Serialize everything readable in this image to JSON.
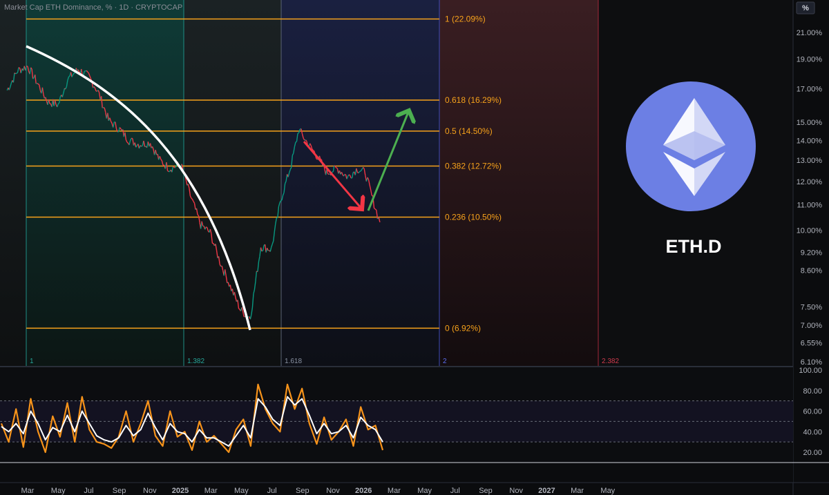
{
  "header": {
    "legend": "Market Cap ETH Dominance, % · 1D · CRYPTOCAP",
    "unit_button": "%"
  },
  "overlay": {
    "ticker": "ETH.D",
    "logo": "ethereum-icon",
    "logo_color": "#6c7fe4"
  },
  "chart_data": [
    {
      "type": "line",
      "title": "",
      "xlabel": "",
      "ylabel": "",
      "y_scale": "log",
      "ylim": [
        6.1,
        22.8
      ],
      "y_ticks": [
        "21.00%",
        "19.00%",
        "17.00%",
        "15.00%",
        "14.00%",
        "13.00%",
        "12.00%",
        "11.00%",
        "10.00%",
        "9.20%",
        "8.60%",
        "7.50%",
        "7.00%",
        "6.55%",
        "6.10%"
      ],
      "x_ticks": [
        "Mar",
        "May",
        "Jul",
        "Sep",
        "Nov",
        "2025",
        "Mar",
        "May",
        "Jul",
        "Sep",
        "Nov",
        "2026",
        "Mar",
        "May",
        "Jul",
        "Sep",
        "Nov",
        "2027",
        "Mar",
        "May"
      ],
      "x_range": [
        "2024-02",
        "2027-06"
      ],
      "series": [
        {
          "name": "",
          "color": "#089981",
          "x": [
            "2024-01-20",
            "2024-02-10",
            "2024-03-01",
            "2024-03-20",
            "2024-04-10",
            "2024-05-01",
            "2024-05-20",
            "2024-06-10",
            "2024-07-01",
            "2024-07-20",
            "2024-08-10",
            "2024-09-01",
            "2024-09-20",
            "2024-10-10",
            "2024-11-01",
            "2024-11-20",
            "2024-12-10",
            "2025-01-01",
            "2025-01-20",
            "2025-02-10",
            "2025-03-01",
            "2025-03-20",
            "2025-04-10",
            "2025-05-01",
            "2025-05-20",
            "2025-06-10",
            "2025-07-01",
            "2025-07-20",
            "2025-08-10",
            "2025-08-25",
            "2025-09-10",
            "2025-10-01",
            "2025-10-20",
            "2025-11-10",
            "2025-12-01",
            "2025-12-20",
            "2026-01-05",
            "2026-01-20",
            "2026-02-03"
          ],
          "y": [
            16.9,
            18.2,
            18.5,
            17.4,
            16.2,
            16.0,
            17.6,
            18.3,
            17.8,
            16.8,
            15.1,
            14.6,
            14.0,
            13.8,
            13.9,
            13.0,
            12.6,
            12.8,
            11.4,
            10.2,
            9.9,
            8.9,
            8.1,
            7.4,
            7.2,
            9.4,
            9.3,
            11.2,
            12.8,
            14.6,
            13.9,
            13.2,
            12.4,
            12.6,
            12.2,
            12.6,
            12.4,
            11.2,
            10.3
          ]
        }
      ],
      "fib_retracement": [
        {
          "label": "1 (22.09%)",
          "value": 22.09
        },
        {
          "label": "0.618 (16.29%)",
          "value": 16.29
        },
        {
          "label": "0.5 (14.50%)",
          "value": 14.5
        },
        {
          "label": "0.382 (12.72%)",
          "value": 12.72
        },
        {
          "label": "0.236 (10.50%)",
          "value": 10.5
        },
        {
          "label": "0 (6.92%)",
          "value": 6.92
        }
      ],
      "fib_time_zones": [
        "1",
        "1.382",
        "1.618",
        "2",
        "2.382"
      ],
      "annotations": [
        "white-curve-downtrend",
        "red-arrow-down",
        "green-arrow-up"
      ]
    },
    {
      "type": "line",
      "title": "",
      "ylim": [
        10,
        100
      ],
      "y_ticks": [
        "100.00",
        "80.00",
        "60.00",
        "40.00",
        "20.00"
      ],
      "bands": [
        70,
        50,
        30
      ],
      "series": [
        {
          "name": "",
          "color": "#f7931a",
          "values": [
            48,
            30,
            62,
            25,
            72,
            40,
            20,
            55,
            35,
            68,
            30,
            74,
            42,
            30,
            28,
            24,
            35,
            60,
            30,
            48,
            70,
            36,
            26,
            60,
            35,
            40,
            22,
            50,
            30,
            36,
            28,
            20,
            42,
            52,
            26,
            86,
            62,
            48,
            40,
            86,
            62,
            82,
            48,
            28,
            54,
            32,
            40,
            52,
            26,
            64,
            42,
            46,
            22
          ]
        },
        {
          "name": "",
          "color": "#ffffff",
          "values": [
            45,
            40,
            48,
            38,
            60,
            48,
            32,
            44,
            40,
            56,
            40,
            60,
            48,
            36,
            32,
            30,
            34,
            46,
            36,
            42,
            58,
            44,
            32,
            48,
            40,
            38,
            30,
            42,
            34,
            34,
            30,
            26,
            36,
            46,
            34,
            72,
            64,
            52,
            46,
            74,
            66,
            72,
            56,
            38,
            48,
            38,
            40,
            46,
            34,
            54,
            46,
            42,
            30
          ]
        }
      ]
    }
  ]
}
